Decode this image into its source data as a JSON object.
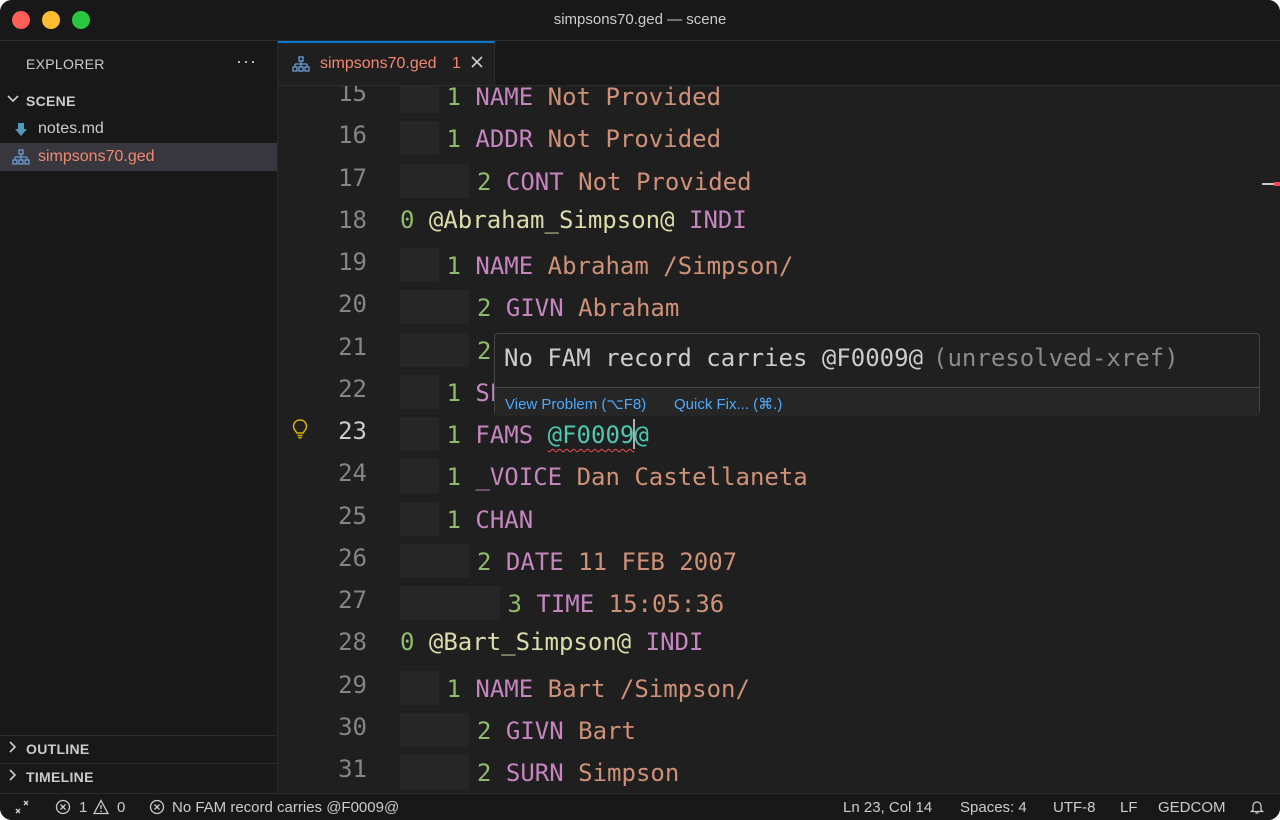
{
  "window": {
    "title": "simpsons70.ged — scene"
  },
  "sidebar": {
    "header": "EXPLORER",
    "more_label": "···",
    "folder": "SCENE",
    "files": [
      {
        "name": "notes.md",
        "icon": "markdown-download-icon",
        "active": false
      },
      {
        "name": "simpsons70.ged",
        "icon": "gedcom-tree-icon",
        "active": true
      }
    ],
    "outline": "OUTLINE",
    "timeline": "TIMELINE"
  },
  "tab": {
    "name": "simpsons70.ged",
    "problem_count": "1"
  },
  "editor": {
    "lines": [
      {
        "n": "15",
        "indent": 1,
        "level": "1",
        "tag": "NAME",
        "value": "Not Provided"
      },
      {
        "n": "16",
        "indent": 1,
        "level": "1",
        "tag": "ADDR",
        "value": "Not Provided"
      },
      {
        "n": "17",
        "indent": 2,
        "level": "2",
        "tag": "CONT",
        "value": "Not Provided"
      },
      {
        "n": "18",
        "indent": 0,
        "level": "0",
        "xref": "@Abraham_Simpson@",
        "tag": "INDI"
      },
      {
        "n": "19",
        "indent": 1,
        "level": "1",
        "tag": "NAME",
        "value": "Abraham /Simpson/"
      },
      {
        "n": "20",
        "indent": 2,
        "level": "2",
        "tag": "GIVN",
        "value": "Abraham"
      },
      {
        "n": "21",
        "indent": 2,
        "level": "2"
      },
      {
        "n": "22",
        "indent": 1,
        "level": "1",
        "tag": "SE"
      },
      {
        "n": "23",
        "indent": 1,
        "level": "1",
        "tag": "FAMS",
        "pointer": "@F0009",
        "pointer_tail": "@"
      },
      {
        "n": "24",
        "indent": 1,
        "level": "1",
        "tag": "_VOICE",
        "value": "Dan Castellaneta"
      },
      {
        "n": "25",
        "indent": 1,
        "level": "1",
        "tag": "CHAN"
      },
      {
        "n": "26",
        "indent": 2,
        "level": "2",
        "tag": "DATE",
        "value": "11 FEB 2007"
      },
      {
        "n": "27",
        "indent": 3,
        "level": "3",
        "tag": "TIME",
        "value": "15:05:36"
      },
      {
        "n": "28",
        "indent": 0,
        "level": "0",
        "xref": "@Bart_Simpson@",
        "tag": "INDI"
      },
      {
        "n": "29",
        "indent": 1,
        "level": "1",
        "tag": "NAME",
        "value": "Bart /Simpson/"
      },
      {
        "n": "30",
        "indent": 2,
        "level": "2",
        "tag": "GIVN",
        "value": "Bart"
      },
      {
        "n": "31",
        "indent": 2,
        "level": "2",
        "tag": "SURN",
        "value": "Simpson"
      }
    ],
    "current_line": "23"
  },
  "hover": {
    "message": "No FAM record carries @F0009@",
    "source": "(unresolved-xref)",
    "view_problem": "View Problem (⌥F8)",
    "quick_fix": "Quick Fix... (⌘.)"
  },
  "statusbar": {
    "errors": "1",
    "warnings": "0",
    "problem": "No FAM record carries @F0009@",
    "position": "Ln 23, Col 14",
    "spaces": "Spaces: 4",
    "encoding": "UTF-8",
    "eol": "LF",
    "language": "GEDCOM"
  },
  "colors": {
    "accent": "#0078d4",
    "error": "#f14c4c",
    "tab_error_text": "#f48771",
    "link": "#4daafc"
  }
}
